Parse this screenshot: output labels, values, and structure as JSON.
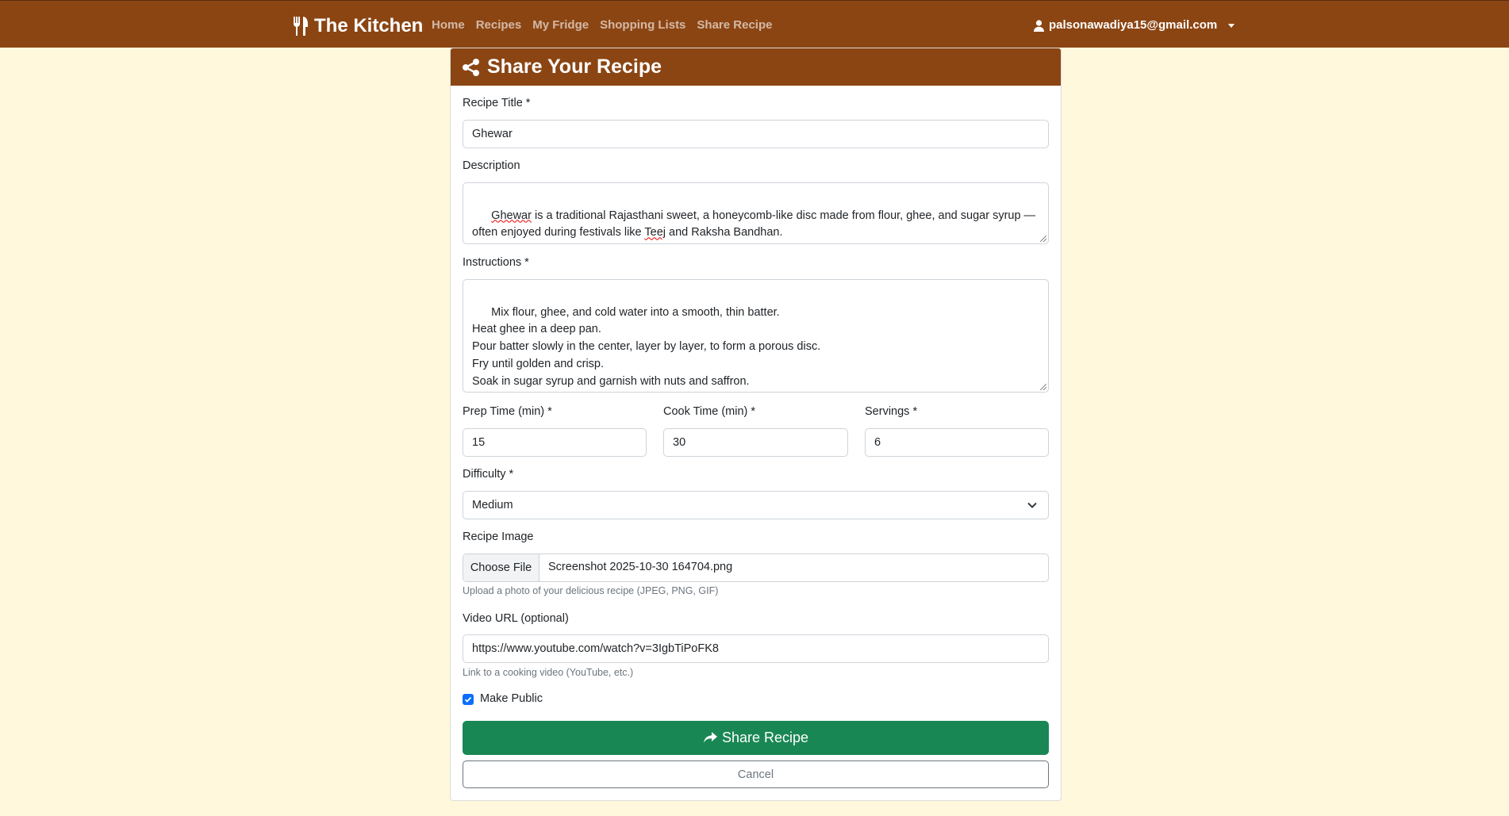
{
  "nav": {
    "brand": "The Kitchen",
    "links": [
      "Home",
      "Recipes",
      "My Fridge",
      "Shopping Lists",
      "Share Recipe"
    ],
    "user_email": "palsonawadiya15@gmail.com"
  },
  "card": {
    "title": "Share Your Recipe"
  },
  "form": {
    "title_label": "Recipe Title *",
    "title_value": "Ghewar",
    "description_label": "Description",
    "description_value": "Ghewar is a traditional Rajasthani sweet, a honeycomb-like disc made from flour, ghee, and sugar syrup — often enjoyed during festivals like Teej and Raksha Bandhan.",
    "instructions_label": "Instructions *",
    "instructions_value": "Mix flour, ghee, and cold water into a smooth, thin batter.\nHeat ghee in a deep pan.\nPour batter slowly in the center, layer by layer, to form a porous disc.\nFry until golden and crisp.\nSoak in sugar syrup and garnish with nuts and saffron.",
    "prep_label": "Prep Time (min) *",
    "prep_value": "15",
    "cook_label": "Cook Time (min) *",
    "cook_value": "30",
    "servings_label": "Servings *",
    "servings_value": "6",
    "difficulty_label": "Difficulty *",
    "difficulty_value": "Medium",
    "image_label": "Recipe Image",
    "choose_file": "Choose File",
    "file_name": "Screenshot 2025-10-30 164704.png",
    "image_help": "Upload a photo of your delicious recipe (JPEG, PNG, GIF)",
    "video_label": "Video URL (optional)",
    "video_value": "https://www.youtube.com/watch?v=3IgbTiPoFK8",
    "video_help": "Link to a cooking video (YouTube, etc.)",
    "public_label": "Make Public",
    "public_checked": true,
    "submit_label": "Share Recipe",
    "cancel_label": "Cancel"
  },
  "colors": {
    "navbar": "#8b4513",
    "background": "#fff8dc",
    "primary_button": "#198754",
    "checkbox": "#0d6efd"
  },
  "icons": {
    "brand": "utensils-icon",
    "user": "user-icon",
    "header": "share-nodes-icon",
    "submit": "share-arrow-icon"
  }
}
